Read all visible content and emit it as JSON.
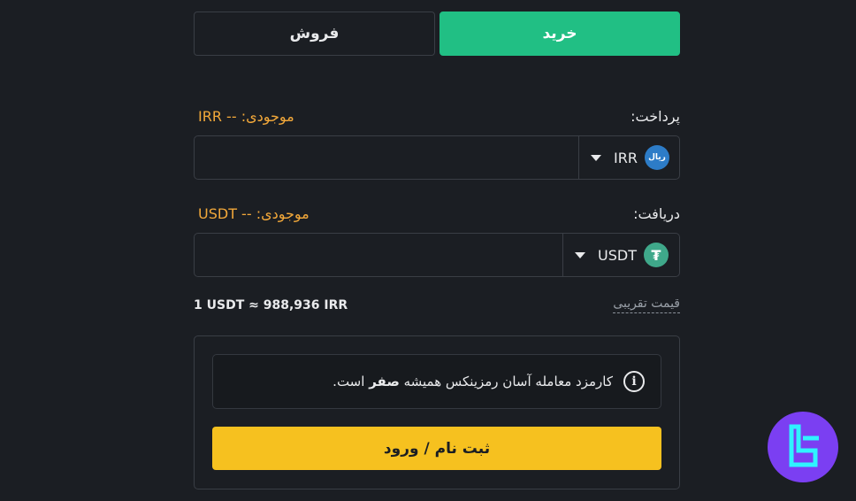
{
  "tabs": {
    "buy": "خرید",
    "sell": "فروش"
  },
  "pay": {
    "label": "پرداخت:",
    "balance_label": "موجودی:",
    "balance_value": "IRR --",
    "currency": "IRR",
    "coin_text": "ریال",
    "input_value": ""
  },
  "receive": {
    "label": "دریافت:",
    "balance_label": "موجودی:",
    "balance_value": "USDT --",
    "currency": "USDT",
    "coin_text": "₮",
    "input_value": ""
  },
  "rate": {
    "text": "1 USDT ≈ 988,936 IRR",
    "label": "قیمت تقریبی"
  },
  "notice": {
    "text_before": "کارمزد معامله آسان رمزینکس همیشه ",
    "text_bold": "صفر",
    "text_after": " است."
  },
  "cta": {
    "label": "ثبت نام / ورود"
  },
  "colors": {
    "buy_accent": "#21bf84",
    "cta_accent": "#f6c11f",
    "balance": "#f2a83a",
    "logo": "#7b3ff2"
  }
}
